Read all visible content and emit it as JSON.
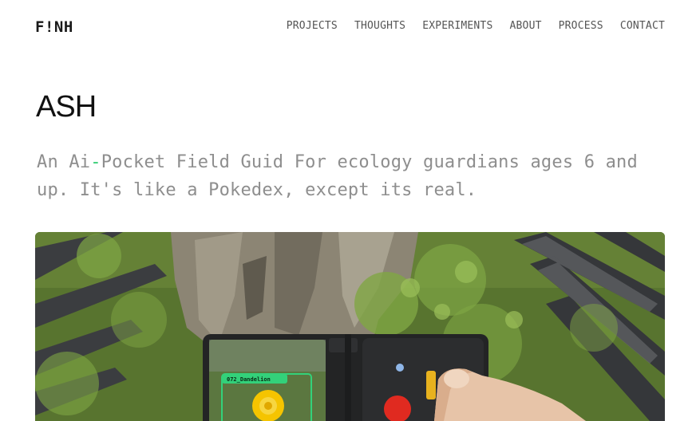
{
  "header": {
    "logo": {
      "prefix": "F",
      "bang": "!",
      "suffix": "NH"
    },
    "nav": [
      {
        "label": "PROJECTS"
      },
      {
        "label": "THOUGHTS"
      },
      {
        "label": "EXPERIMENTS"
      },
      {
        "label": "ABOUT"
      },
      {
        "label": "PROCESS"
      },
      {
        "label": "CONTACT"
      }
    ]
  },
  "page": {
    "title": "ASH",
    "subtitle": {
      "part1": "An Ai",
      "dash": "-",
      "part2": "Pocket Field Guid For ecology guardians ages 6 and up. It's like a Pokedex, except its real."
    }
  },
  "hero_image": {
    "device_label": "072_Dandelion",
    "colors": {
      "accent": "#2ecc71",
      "button": "#e02a20",
      "device": "#2a2a2a"
    }
  }
}
